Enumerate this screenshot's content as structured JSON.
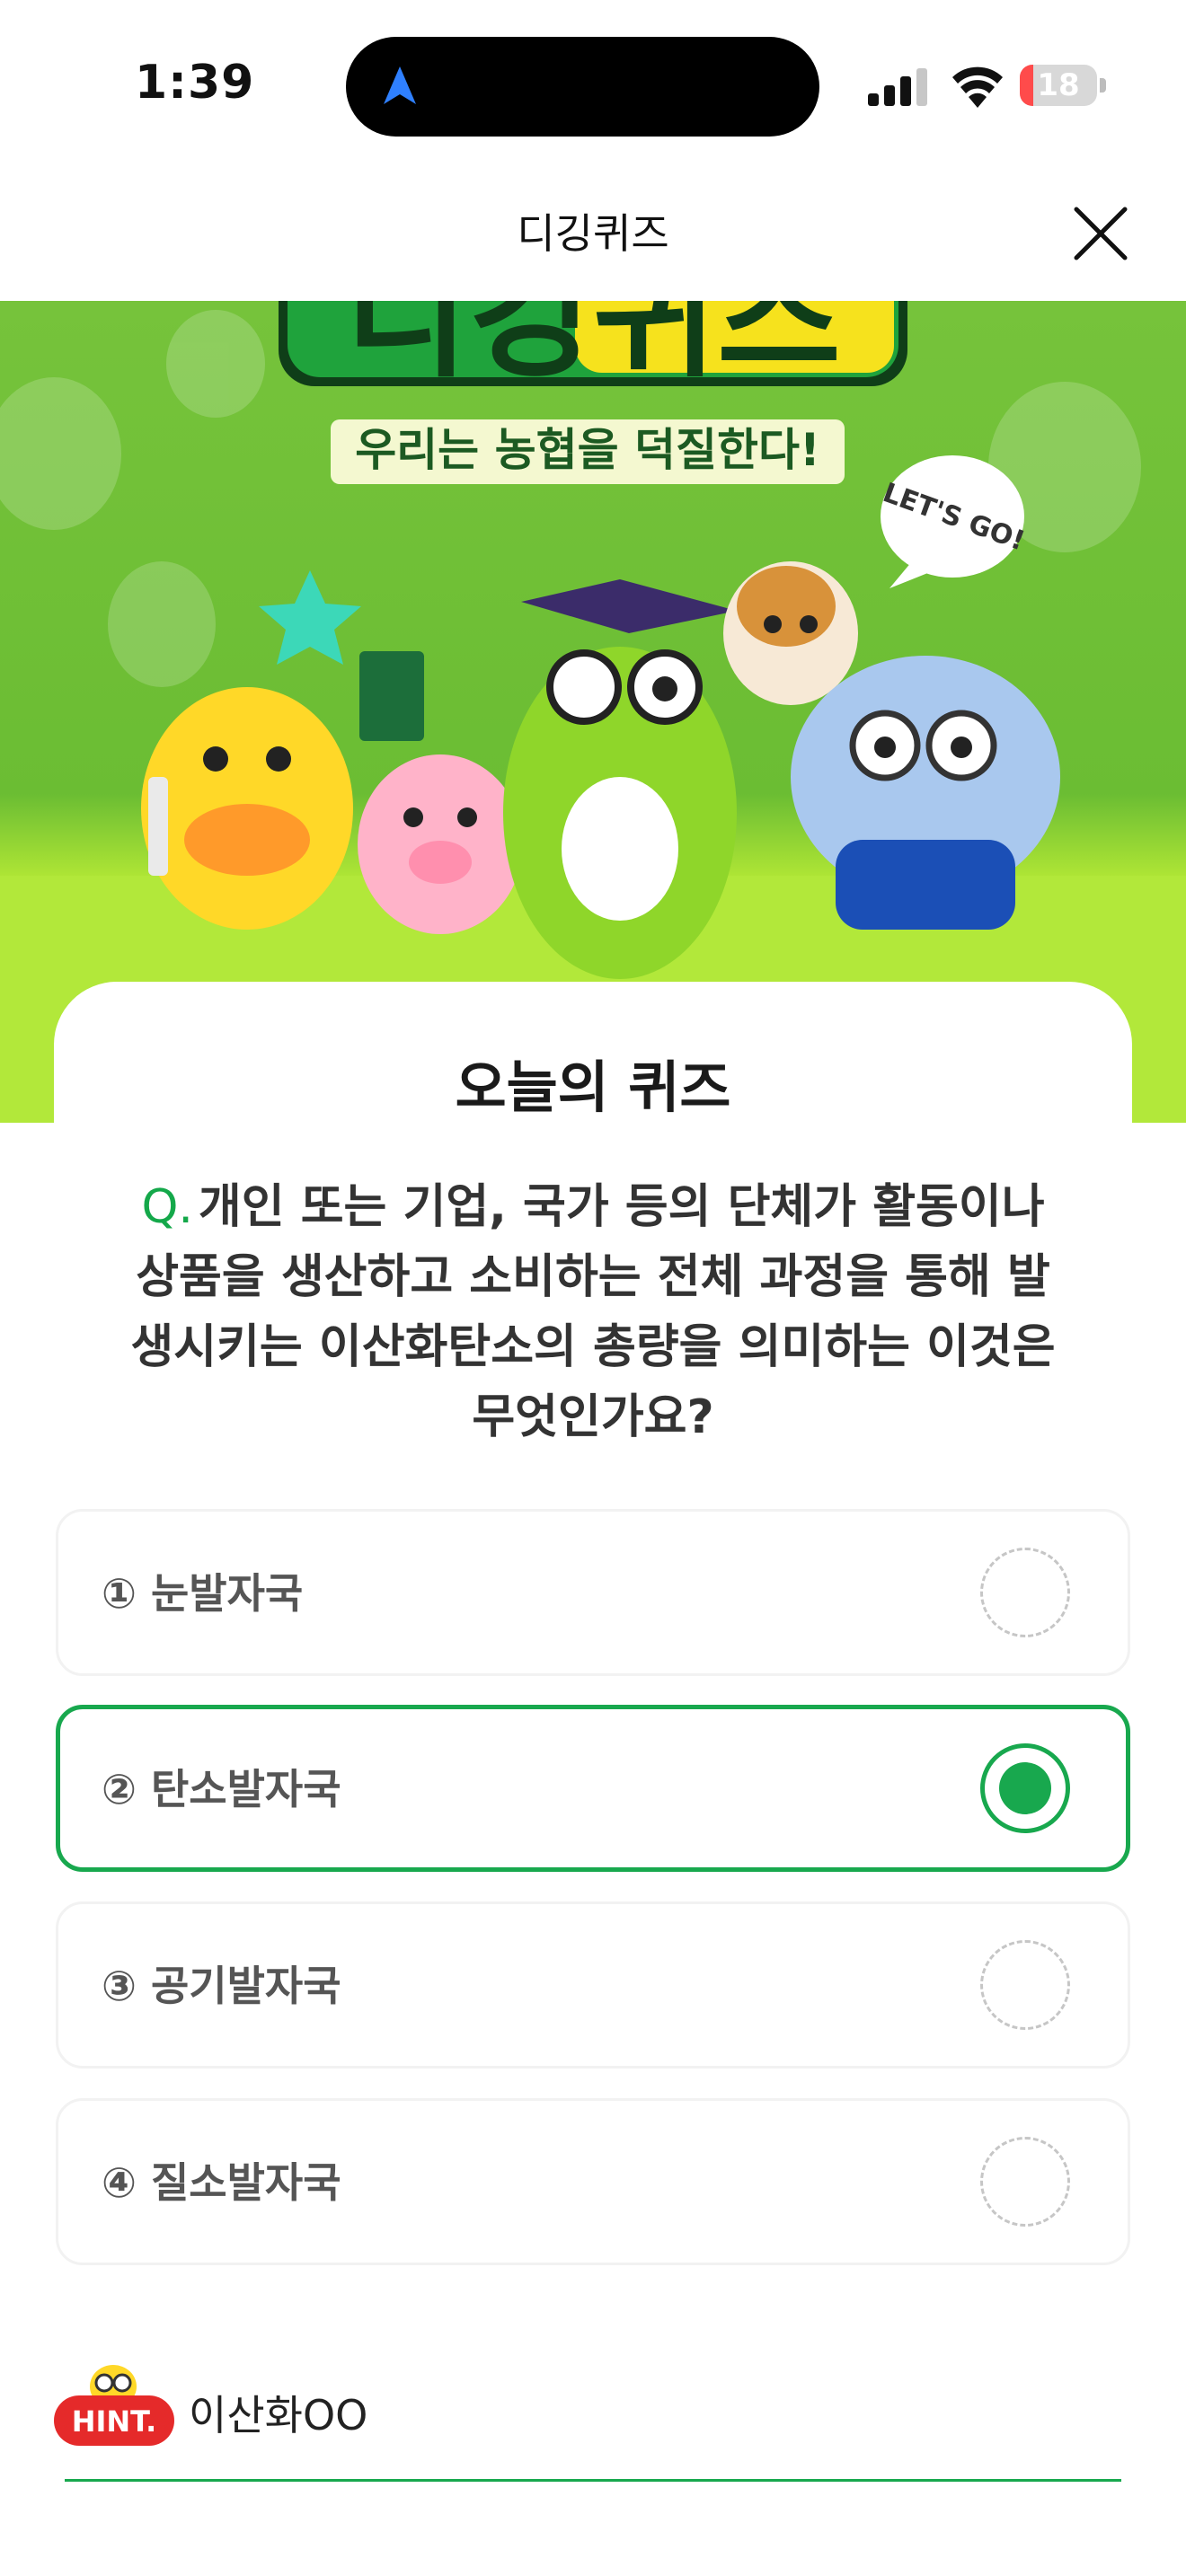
{
  "status_bar": {
    "time": "1:39",
    "battery_level": "18",
    "battery_fraction": 0.18,
    "nav_icon": "location-arrow-icon",
    "signal_icon": "cellular-signal-icon",
    "wifi_icon": "wifi-icon",
    "colors": {
      "battery_low": "#ff4b4b",
      "nav_arrow": "#2f80ff"
    }
  },
  "header": {
    "title": "디깅퀴즈",
    "close_icon": "close-icon"
  },
  "banner": {
    "logo_text": "디깅퀴즈",
    "slogan": "우리는 농협을 덕질한다!",
    "speech_bubble": "LET'S GO!",
    "colors": {
      "background": "#6bbd33",
      "floor": "#b4ea3d"
    }
  },
  "quiz": {
    "title": "오늘의 퀴즈",
    "question_prefix": "Q.",
    "question": "개인 또는 기업, 국가 등의 단체가 활동이나 상품을 생산하고 소비하는 전체 과정을 통해 발생시키는 이산화탄소의 총량을 의미하는 이것은 무엇인가요?",
    "options": [
      {
        "label": "① 눈발자국",
        "selected": false
      },
      {
        "label": "② 탄소발자국",
        "selected": true
      },
      {
        "label": "③ 공기발자국",
        "selected": false
      },
      {
        "label": "④ 질소발자국",
        "selected": false
      }
    ],
    "accent_color": "#18a84e"
  },
  "hint": {
    "badge": "HINT.",
    "text": "이산화OO",
    "badge_color": "#e52a2a"
  }
}
